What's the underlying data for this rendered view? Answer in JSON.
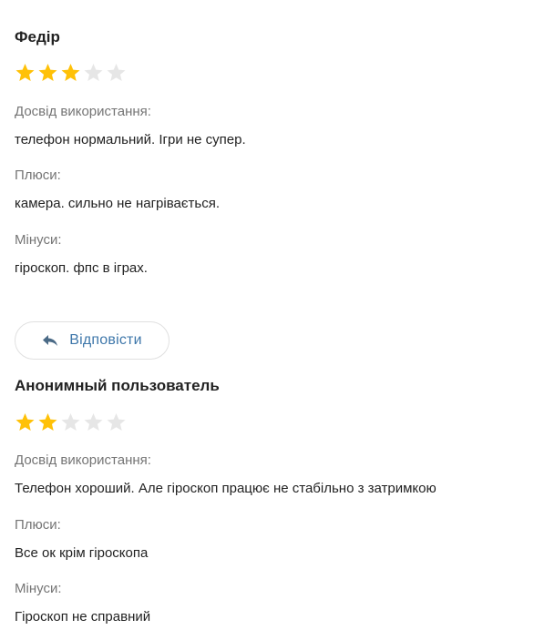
{
  "reviews": [
    {
      "author": "Федір",
      "rating": 3,
      "max_rating": 5,
      "sections": [
        {
          "label": "Досвід використання:",
          "text": "телефон нормальний. Ігри не супер."
        },
        {
          "label": "Плюси:",
          "text": "камера. сильно не нагрівається."
        },
        {
          "label": "Мінуси:",
          "text": "гіроскоп. фпс в іграх."
        }
      ]
    },
    {
      "author": "Анонимный пользователь",
      "rating": 2,
      "max_rating": 5,
      "sections": [
        {
          "label": "Досвід використання:",
          "text": "Телефон хороший. Але гіроскоп працює не стабільно з затримкою"
        },
        {
          "label": "Плюси:",
          "text": "Все ок крім гіроскопа"
        },
        {
          "label": "Мінуси:",
          "text": "Гіроскоп не справний"
        }
      ]
    }
  ],
  "reply_button": {
    "label": "Відповісти",
    "icon": "reply-arrow-icon"
  },
  "colors": {
    "star_filled": "#FFC107",
    "star_empty": "#E6E6E6",
    "label_text": "#757575",
    "body_text": "#222222",
    "link_text": "#3E77AA",
    "button_border": "#E0E0E0"
  }
}
